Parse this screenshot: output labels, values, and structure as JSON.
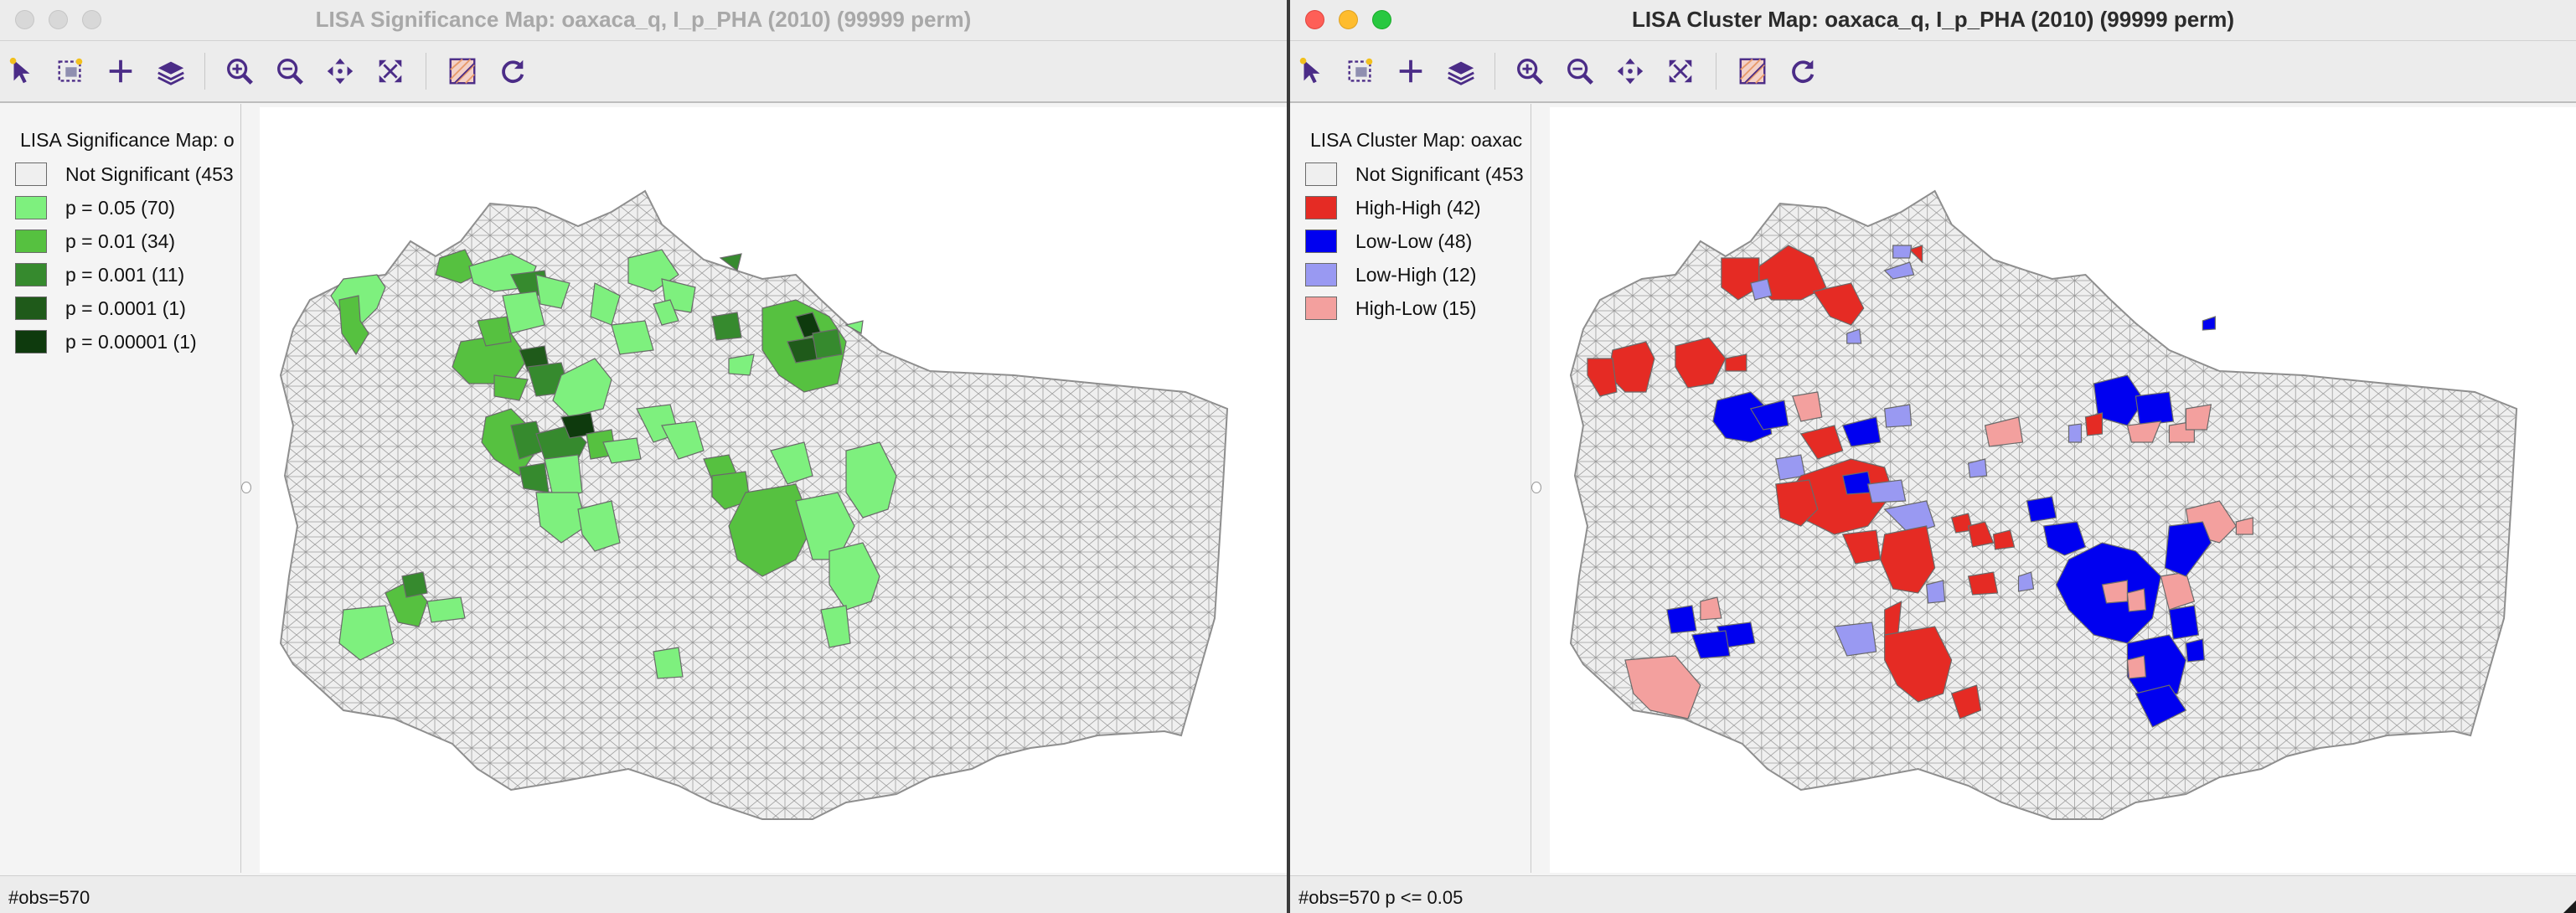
{
  "colors": {
    "not_significant": "#efefef",
    "p_05": "#7ef07e",
    "p_01": "#56c140",
    "p_001": "#368a2e",
    "p_0001": "#1f5a1a",
    "p_00001": "#0e3a0d",
    "high_high": "#e52b24",
    "low_low": "#0000f0",
    "low_high": "#9999f2",
    "high_low": "#f3a09e",
    "toolbar_icon": "#4b2c87"
  },
  "left_window": {
    "title": "LISA Significance Map: oaxaca_q, I_p_PHA (2010) (99999 perm)",
    "toolbar_icons": [
      "select-arrow-icon",
      "select-table-icon",
      "add-plus-icon",
      "layers-icon",
      "zoom-in-icon",
      "zoom-out-icon",
      "pan-icon",
      "fit-extent-icon",
      "basemap-icon",
      "refresh-icon"
    ],
    "legend_title": "LISA Significance Map: o",
    "legend": [
      {
        "label": "Not Significant (453",
        "color": "#efefef"
      },
      {
        "label": "p = 0.05 (70)",
        "color": "#7ef07e"
      },
      {
        "label": "p = 0.01 (34)",
        "color": "#56c140"
      },
      {
        "label": "p = 0.001 (11)",
        "color": "#368a2e"
      },
      {
        "label": "p = 0.0001 (1)",
        "color": "#1f5a1a"
      },
      {
        "label": "p = 0.00001 (1)",
        "color": "#0e3a0d"
      }
    ],
    "status": "#obs=570"
  },
  "right_window": {
    "title": "LISA Cluster Map: oaxaca_q, I_p_PHA (2010) (99999 perm)",
    "toolbar_icons": [
      "select-arrow-icon",
      "select-table-icon",
      "add-plus-icon",
      "layers-icon",
      "zoom-in-icon",
      "zoom-out-icon",
      "pan-icon",
      "fit-extent-icon",
      "basemap-icon",
      "refresh-icon"
    ],
    "legend_title": "LISA Cluster Map: oaxac",
    "legend": [
      {
        "label": "Not Significant (453",
        "color": "#efefef"
      },
      {
        "label": "High-High (42)",
        "color": "#e52b24"
      },
      {
        "label": "Low-Low (48)",
        "color": "#0000f0"
      },
      {
        "label": "Low-High (12)",
        "color": "#9999f2"
      },
      {
        "label": "High-Low (15)",
        "color": "#f3a09e"
      }
    ],
    "status": "#obs=570  p <= 0.05"
  }
}
